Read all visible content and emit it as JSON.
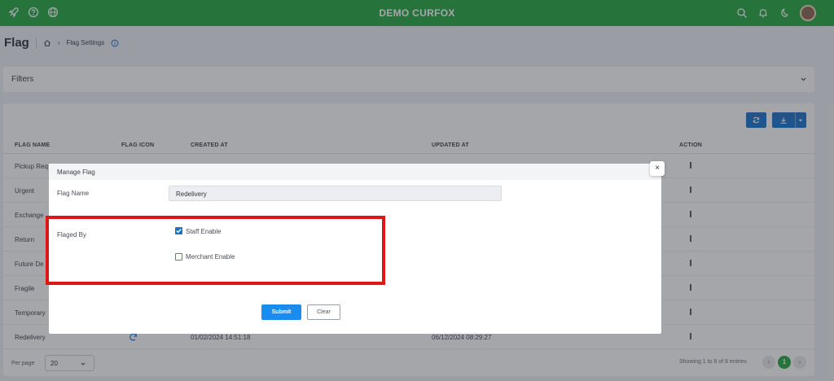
{
  "app": {
    "brand": "DEMO CURFOX"
  },
  "breadcrumb": {
    "title": "Flag",
    "current": "Flag Settings"
  },
  "filters": {
    "label": "Filters"
  },
  "table": {
    "columns": [
      "FLAG NAME",
      "FLAG ICON",
      "CREATED AT",
      "UPDATED AT",
      "ACTION"
    ],
    "rows": [
      {
        "name": "Pickup Req",
        "created": "",
        "updated": ""
      },
      {
        "name": "Urgent",
        "created": "",
        "updated": ""
      },
      {
        "name": "Exchange",
        "created": "",
        "updated": ""
      },
      {
        "name": "Return",
        "created": "",
        "updated": ""
      },
      {
        "name": "Future De",
        "created": "",
        "updated": ""
      },
      {
        "name": "Fragile",
        "created": "",
        "updated": ""
      },
      {
        "name": "Temporary",
        "created": "",
        "updated": ""
      },
      {
        "name": "Redelivery",
        "created": "01/02/2024 14:51:18",
        "updated": "06/12/2024 08:29:27"
      }
    ],
    "per_page_label": "Per page",
    "per_page_value": "20",
    "showing": "Showing 1 to 8 of 8 entries",
    "current_page": "1"
  },
  "modal": {
    "title": "Manage Flag",
    "flag_name_label": "Flag Name",
    "flag_name_value": "Redelivery",
    "flaged_by_label": "Flaged By",
    "staff_enable_label": "Staff Enable",
    "staff_enable_checked": true,
    "merchant_enable_label": "Merchant Enable",
    "merchant_enable_checked": false,
    "submit_label": "Submit",
    "clear_label": "Clear",
    "close_label": "×"
  },
  "colors": {
    "brand": "#27a743",
    "primary": "#1a8cf0",
    "highlight": "#e01616"
  }
}
